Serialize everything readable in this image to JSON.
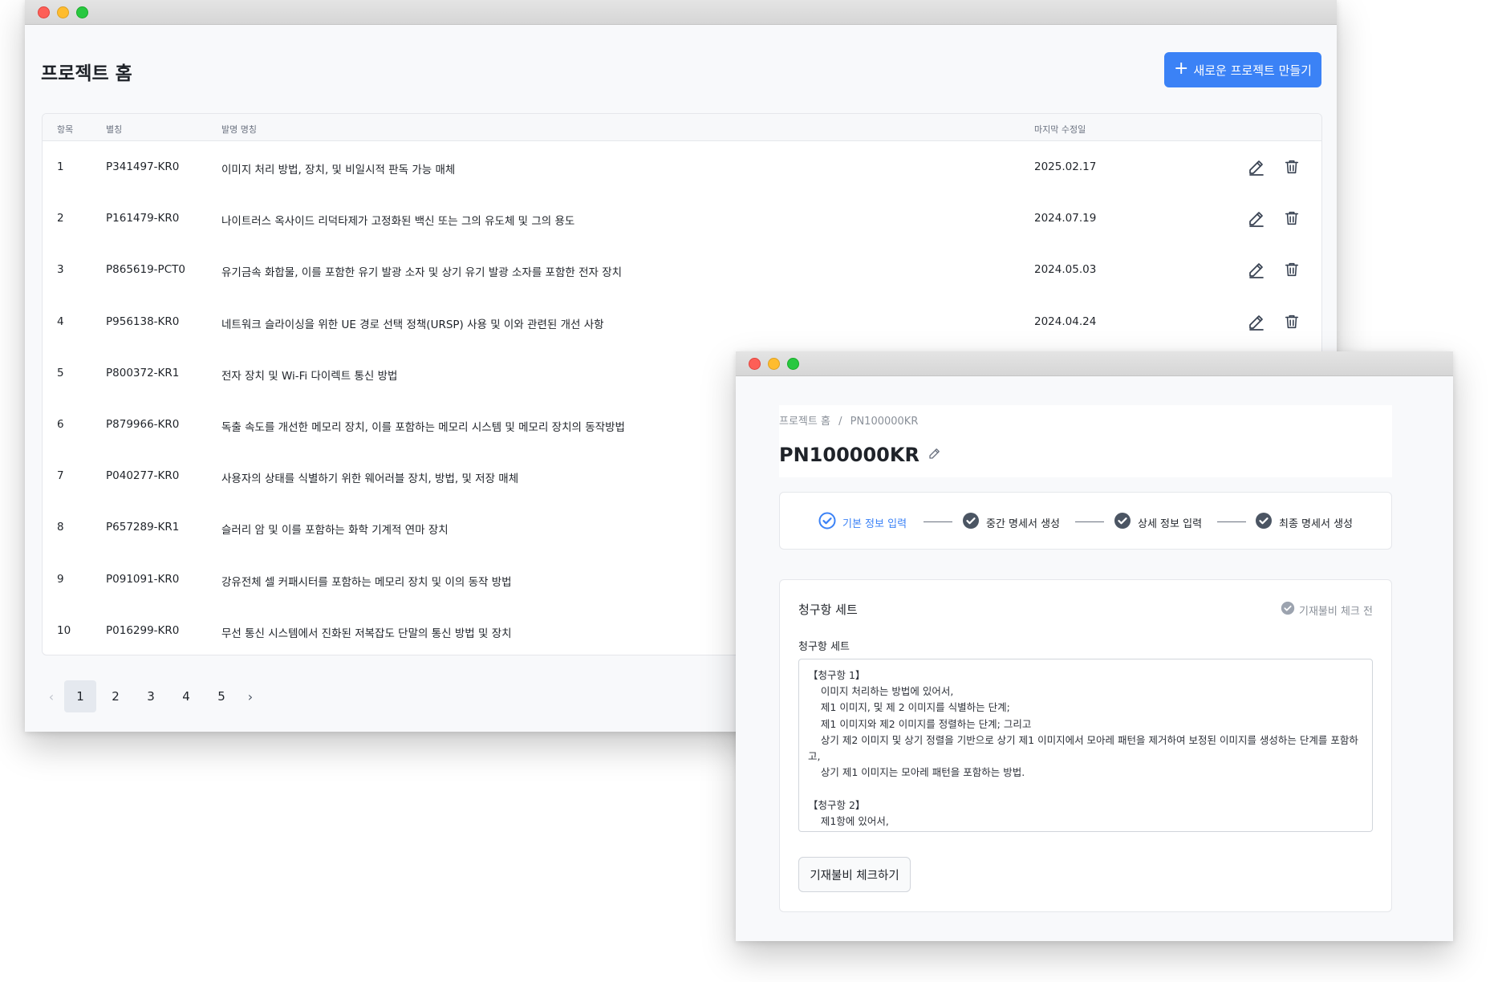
{
  "list_window": {
    "title": "프로젝트 홈",
    "new_project_label": "새로운 프로젝트 만들기",
    "columns": {
      "no": "항목",
      "alias": "별칭",
      "name": "발명 명칭",
      "date": "마지막 수정일"
    },
    "rows": [
      {
        "no": "1",
        "alias": "P341497-KR0",
        "name": "이미지 처리 방법, 장치, 및 비일시적 판독 가능 매체",
        "date": "2025.02.17"
      },
      {
        "no": "2",
        "alias": "P161479-KR0",
        "name": "나이트러스 옥사이드 리덕타제가 고정화된 백신 또는 그의 유도체 및 그의 용도",
        "date": "2024.07.19"
      },
      {
        "no": "3",
        "alias": "P865619-PCT0",
        "name": "유기금속 화합물, 이를 포함한 유기 발광 소자 및 상기 유기 발광 소자를 포함한 전자 장치",
        "date": "2024.05.03"
      },
      {
        "no": "4",
        "alias": "P956138-KR0",
        "name": "네트워크 슬라이싱을 위한 UE 경로 선택 정책(URSP) 사용 및 이와 관련된 개선 사항",
        "date": "2024.04.24"
      },
      {
        "no": "5",
        "alias": "P800372-KR1",
        "name": "전자 장치 및 Wi-Fi 다이렉트 통신 방법",
        "date": ""
      },
      {
        "no": "6",
        "alias": "P879966-KR0",
        "name": "독출 속도를 개선한 메모리 장치, 이를 포함하는 메모리 시스템 및 메모리 장치의 동작방법",
        "date": ""
      },
      {
        "no": "7",
        "alias": "P040277-KR0",
        "name": "사용자의 상태를 식별하기 위한 웨어러블 장치, 방법, 및 저장 매체",
        "date": ""
      },
      {
        "no": "8",
        "alias": "P657289-KR1",
        "name": "슬러리 암 및 이를 포함하는 화학 기계적 연마 장치",
        "date": ""
      },
      {
        "no": "9",
        "alias": "P091091-KR0",
        "name": "강유전체 셀 커패시터를 포함하는 메모리 장치 및 이의 동작 방법",
        "date": ""
      },
      {
        "no": "10",
        "alias": "P016299-KR0",
        "name": "무선 통신 시스템에서 진화된 저복잡도 단말의 통신 방법 및 장치",
        "date": ""
      }
    ],
    "pagination": {
      "prev_icon": "chevron-left-icon",
      "pages": [
        "1",
        "2",
        "3",
        "4",
        "5"
      ],
      "current": "1",
      "next_icon": "chevron-right-icon"
    }
  },
  "detail_window": {
    "breadcrumb": {
      "home": "프로젝트 홈",
      "separator": "/",
      "current": "PN100000KR"
    },
    "title": "PN100000KR",
    "steps": [
      {
        "label": "기본 정보 입력",
        "state": "active"
      },
      {
        "label": "중간 명세서 생성",
        "state": "done"
      },
      {
        "label": "상세 정보 입력",
        "state": "done"
      },
      {
        "label": "최종 명세서 생성",
        "state": "done"
      }
    ],
    "card": {
      "title": "청구항 세트",
      "status": "기재불비 체크 전",
      "field_label": "청구항 세트",
      "claims_text": "【청구항 1】\n    이미지 처리하는 방법에 있어서,\n    제1 이미지, 및 제 2 이미지를 식별하는 단계;\n    제1 이미지와 제2 이미지를 정렬하는 단계; 그리고\n    상기 제2 이미지 및 상기 정렬을 기반으로 상기 제1 이미지에서 모아레 패턴을 제거하여 보정된 이미지를 생성하는 단계를 포함하고,\n    상기 제1 이미지는 모아레 패턴을 포함하는 방법.\n\n【청구항 2】\n    제1항에 있어서,",
      "check_button": "기재불비 체크하기"
    }
  },
  "colors": {
    "accent": "#3b82f6",
    "step_done": "#4b5563",
    "status_gray": "#9ca3af"
  }
}
